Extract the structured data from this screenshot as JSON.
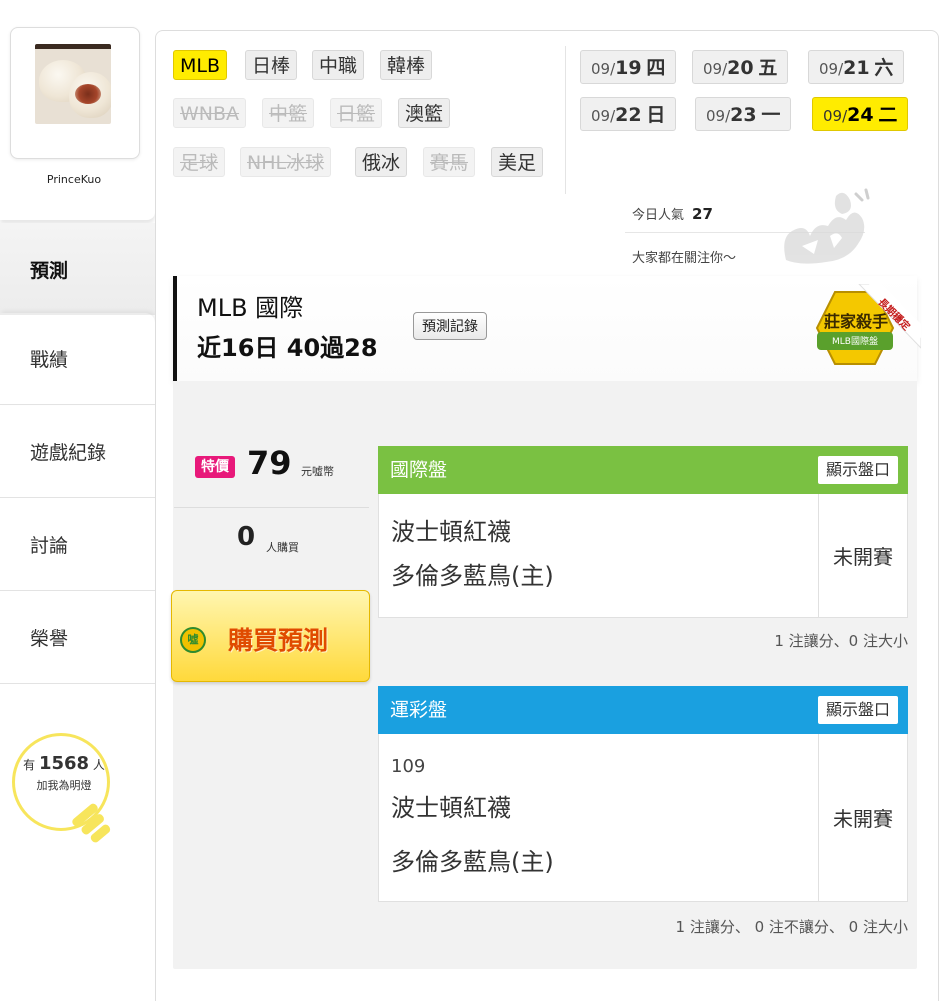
{
  "user": {
    "name": "PrinceKuo"
  },
  "sidebar": {
    "items": [
      {
        "label": "預測",
        "active": true
      },
      {
        "label": "戰績"
      },
      {
        "label": "遊戲紀錄"
      },
      {
        "label": "討論"
      },
      {
        "label": "榮譽"
      }
    ],
    "fans": {
      "prefix": "有",
      "count": "1568",
      "suffix": "人",
      "note": "加我為明燈"
    }
  },
  "sports": {
    "mlb": "MLB",
    "npb": "日棒",
    "cpbl": "中職",
    "kbo": "韓棒",
    "wnba": "WNBA",
    "cba": "中籃",
    "jbl": "日籃",
    "nbl": "澳籃",
    "soccer": "足球",
    "nhl": "NHL冰球",
    "khl": "俄冰",
    "horse": "賽馬",
    "nfl": "美足"
  },
  "dates": [
    {
      "prefix": "09/",
      "day": "19",
      "weekday": "四"
    },
    {
      "prefix": "09/",
      "day": "20",
      "weekday": "五"
    },
    {
      "prefix": "09/",
      "day": "21",
      "weekday": "六"
    },
    {
      "prefix": "09/",
      "day": "22",
      "weekday": "日"
    },
    {
      "prefix": "09/",
      "day": "23",
      "weekday": "一"
    },
    {
      "prefix": "09/",
      "day": "24",
      "weekday": "二",
      "selected": true
    }
  ],
  "popularity": {
    "label": "今日人氣",
    "value": "27",
    "note": "大家都在關注你～"
  },
  "stats": {
    "league": "MLB 國際",
    "record": "近16日 40過28",
    "record_button": "預測記錄",
    "badge_title": "莊家殺手",
    "badge_sub": "MLB國際盤",
    "ribbon": "長期穩定"
  },
  "purchase": {
    "special_label": "特價",
    "price": "79",
    "price_unit": "元噓幣",
    "buyers": "0",
    "buyers_unit": "人購買",
    "buy_button": "購買預測",
    "buy_icon_text": "噓"
  },
  "cards": [
    {
      "title": "國際盤",
      "header_color": "#7ac142",
      "show_button": "顯示盤口",
      "game_no": "",
      "away": "波士頓紅襪",
      "home": "多倫多藍鳥(主)",
      "status": "未開賽",
      "summary": "1 注讓分、0 注大小"
    },
    {
      "title": "運彩盤",
      "header_color": "#1aa0e0",
      "show_button": "顯示盤口",
      "game_no": "109",
      "away": "波士頓紅襪",
      "home": "多倫多藍鳥(主)",
      "status": "未開賽",
      "summary": "1 注讓分、 0 注不讓分、 0 注大小"
    }
  ]
}
